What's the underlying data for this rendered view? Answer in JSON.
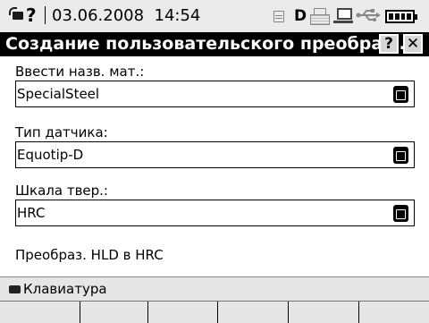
{
  "status_bar": {
    "help_mark": "?",
    "datetime": "03.06.2008  14:54",
    "mode_letter": "D",
    "icons": [
      "keyboard-icon",
      "document-icon",
      "printer-icon",
      "network-icon",
      "usb-icon",
      "battery-icon"
    ]
  },
  "dialog": {
    "title": "Создание пользовательского преобраз...",
    "help_button": "?",
    "close_button": "✕"
  },
  "fields": [
    {
      "label": "Ввести назв. мат.:",
      "value": "SpecialSteel"
    },
    {
      "label": "Тип датчика:",
      "value": "Equotip-D"
    },
    {
      "label": "Шкала твер.:",
      "value": "HRC"
    }
  ],
  "info": "Преобраз. HLD в HRC",
  "keyboard_bar": {
    "label": "Клавиатура"
  },
  "softkeys": [
    "",
    "",
    "",
    "",
    "",
    ""
  ]
}
